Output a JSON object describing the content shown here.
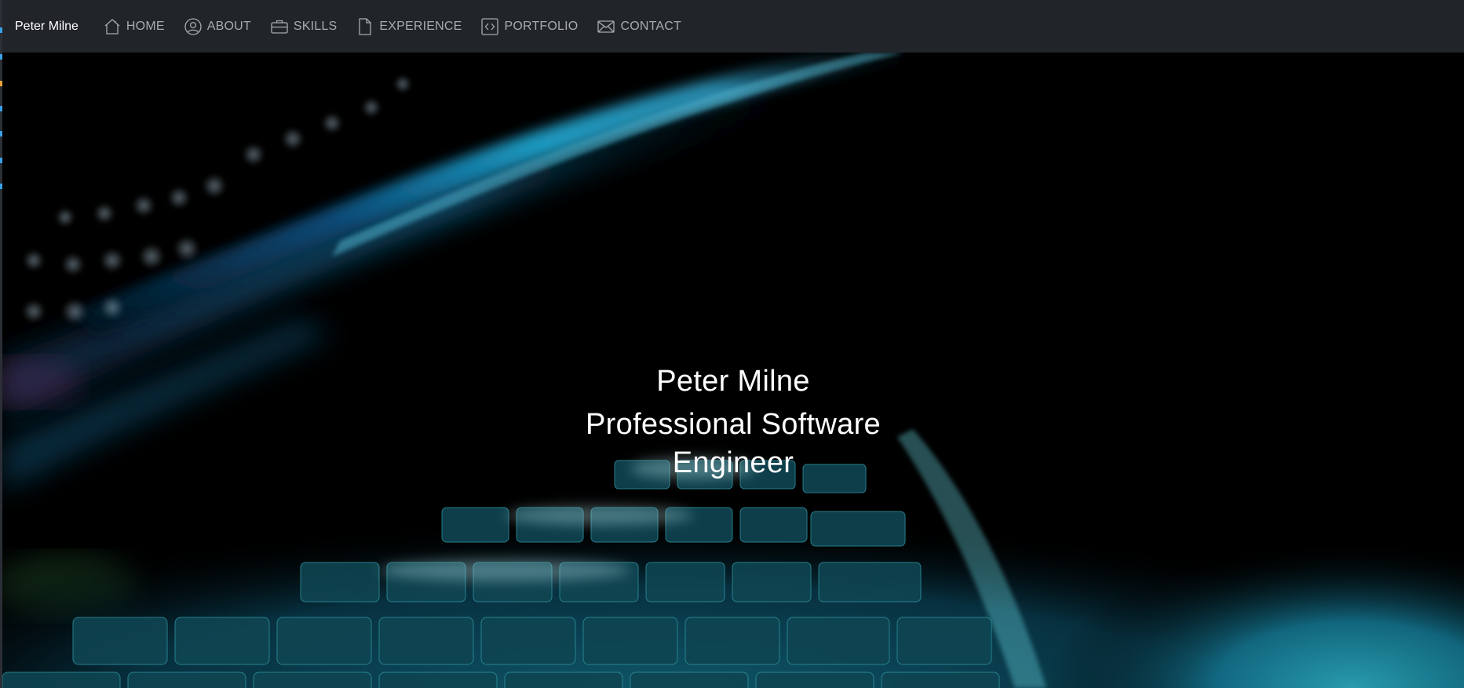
{
  "navbar": {
    "brand": "Peter Milne",
    "items": [
      {
        "label": "HOME",
        "icon": "home-icon"
      },
      {
        "label": "ABOUT",
        "icon": "user-circle-icon"
      },
      {
        "label": "SKILLS",
        "icon": "briefcase-icon"
      },
      {
        "label": "EXPERIENCE",
        "icon": "document-icon"
      },
      {
        "label": "PORTFOLIO",
        "icon": "code-icon"
      },
      {
        "label": "CONTACT",
        "icon": "envelope-icon"
      }
    ]
  },
  "hero": {
    "name": "Peter Milne",
    "title": "Professional Software Engineer"
  },
  "colors": {
    "navbar_bg": "#212429",
    "nav_text": "#a7abaf",
    "brand_text": "#ffffff",
    "hero_text": "#ffffff",
    "accent_teal": "#1ea5b8"
  }
}
